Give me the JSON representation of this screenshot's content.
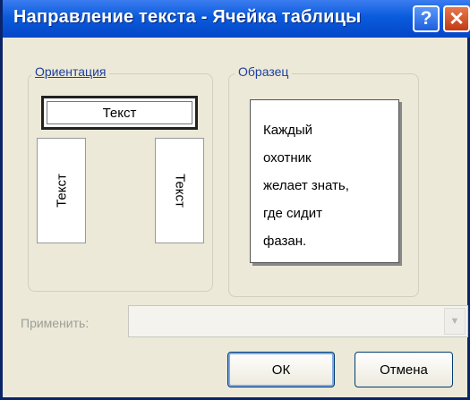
{
  "window": {
    "title": "Направление текста - Ячейка таблицы"
  },
  "titlebar": {
    "help_glyph": "?",
    "close_glyph": "✕"
  },
  "orientation": {
    "legend": "Ориентация",
    "selected": "horizontal",
    "horizontal_label": "Текст",
    "vertical_left_label": "Текст",
    "vertical_right_label": "Текст"
  },
  "sample": {
    "legend": "Образец",
    "lines": [
      "Каждый",
      "охотник",
      "желает знать,",
      "где сидит",
      "фазан."
    ]
  },
  "apply": {
    "label": "Применить:",
    "value": "",
    "dropdown_glyph": "▼",
    "enabled": false
  },
  "buttons": {
    "ok": "ОК",
    "cancel": "Отмена"
  },
  "colors": {
    "titlebar": "#0a5bdc",
    "dialog_bg": "#ece9d8",
    "legend_text": "#1e3f9e",
    "disabled_text": "#9e9e98"
  }
}
